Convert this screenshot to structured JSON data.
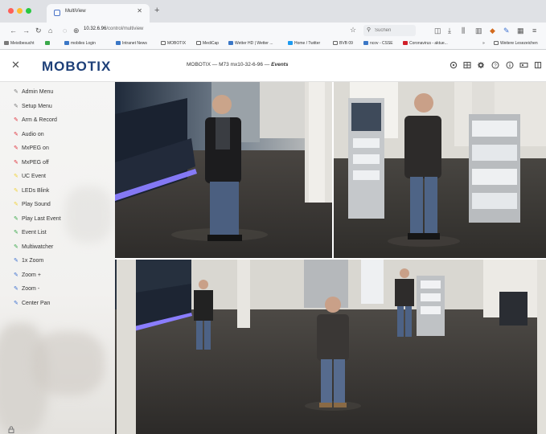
{
  "browser": {
    "tab_title": "MultiView",
    "url_host": "10.32.6.96",
    "url_path": "/control/multiview",
    "search_placeholder": "Suchen",
    "bookmarks": [
      {
        "label": "Meistbesucht",
        "color": "#7a7a7a"
      },
      {
        "label": "mobiles Login",
        "color": "#3b77c6"
      },
      {
        "label": "Intranet News",
        "color": "#3b77c6"
      },
      {
        "label": "MOBOTIX",
        "color": "#666666"
      },
      {
        "label": "MediCap",
        "color": "#666666"
      },
      {
        "label": "Wetter HD | Wetter ...",
        "color": "#3b77c6"
      },
      {
        "label": "Home / Twitter",
        "color": "#1d9bf0"
      },
      {
        "label": "BVB 09",
        "color": "#666666"
      },
      {
        "label": "ncov - CSSE",
        "color": "#3b77c6"
      },
      {
        "label": "Coronavirus - aktue...",
        "color": "#d0202a"
      },
      {
        "label": "Weitere Lesezeichen",
        "color": "#666666"
      }
    ]
  },
  "app": {
    "logo": "MOBOTIX",
    "title_main": "MOBOTIX — M73 mx10-32-6-96 — ",
    "title_view": "Events"
  },
  "menu": [
    {
      "label": "Admin Menu",
      "color": "#7a7a7a"
    },
    {
      "label": "Setup Menu",
      "color": "#7a7a7a"
    },
    {
      "label": "Arm & Record",
      "color": "#e0303a"
    },
    {
      "label": "Audio on",
      "color": "#e0303a"
    },
    {
      "label": "MxPEG on",
      "color": "#e0303a"
    },
    {
      "label": "MxPEG off",
      "color": "#e0303a"
    },
    {
      "label": "UC Event",
      "color": "#f2d33a"
    },
    {
      "label": "LEDs Blink",
      "color": "#f2d33a"
    },
    {
      "label": "Play Sound",
      "color": "#f2d33a"
    },
    {
      "label": "Play Last Event",
      "color": "#3aa84a"
    },
    {
      "label": "Event List",
      "color": "#3aa84a"
    },
    {
      "label": "Multiwatcher",
      "color": "#3aa84a"
    },
    {
      "label": "1x Zoom",
      "color": "#3a6fd0"
    },
    {
      "label": "Zoom +",
      "color": "#3a6fd0"
    },
    {
      "label": "Zoom -",
      "color": "#3a6fd0"
    },
    {
      "label": "Center Pan",
      "color": "#3a6fd0"
    }
  ],
  "header_icons": [
    "settings-gear-icon",
    "grid-view-icon",
    "config-icon",
    "help-icon",
    "info-icon",
    "display-mode-icon",
    "fullscreen-icon"
  ],
  "colors": {
    "brand": "#1d3f78",
    "floor": "#3a3835",
    "led_strip": "#7a6cff"
  }
}
